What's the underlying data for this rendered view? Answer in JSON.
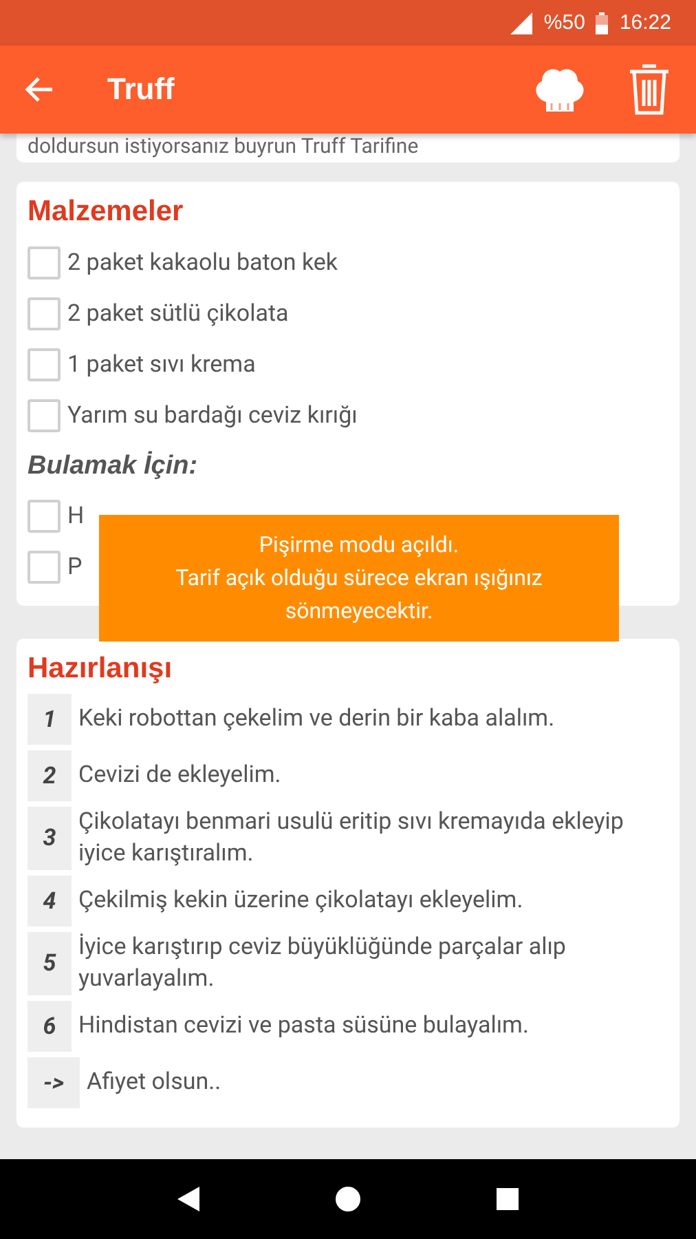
{
  "status_bar": {
    "battery": "%50",
    "time": "16:22"
  },
  "app_bar": {
    "title": "Truff"
  },
  "intro": {
    "text": "doldursun istiyorsanız buyrun Truff Tarifine"
  },
  "ingredients": {
    "title": "Malzemeler",
    "items": [
      {
        "kind": "item",
        "text": "2 paket kakaolu baton kek",
        "checked": false
      },
      {
        "kind": "item",
        "text": "2 paket sütlü çikolata",
        "checked": false
      },
      {
        "kind": "item",
        "text": "1 paket sıvı krema",
        "checked": false
      },
      {
        "kind": "item",
        "text": "Yarım su bardağı ceviz kırığı",
        "checked": false
      },
      {
        "kind": "subheading",
        "text": "Bulamak İçin:"
      },
      {
        "kind": "item",
        "text": "H",
        "checked": false
      },
      {
        "kind": "item",
        "text": "P",
        "checked": false
      }
    ]
  },
  "toast": {
    "lines": [
      "Pişirme modu açıldı.",
      "Tarif açık olduğu sürece ekran ışığınız sönmeyecektir."
    ]
  },
  "steps": {
    "title": "Hazırlanışı",
    "items": [
      {
        "number": "1",
        "text": "Keki robottan çekelim ve derin bir kaba alalım."
      },
      {
        "number": "2",
        "text": "Cevizi de ekleyelim."
      },
      {
        "number": "3",
        "text": "Çikolatayı benmari usulü eritip sıvı kremayıda ekleyip iyice karıştıralım."
      },
      {
        "number": "4",
        "text": "Çekilmiş kekin üzerine çikolatayı ekleyelim."
      },
      {
        "number": "5",
        "text": "İyice karıştırıp ceviz büyüklüğünde parçalar alıp yuvarlayalım."
      },
      {
        "number": "6",
        "text": "Hindistan cevizi ve pasta süsüne bulayalım."
      },
      {
        "number": "->",
        "text": "Afiyet olsun.."
      }
    ]
  }
}
